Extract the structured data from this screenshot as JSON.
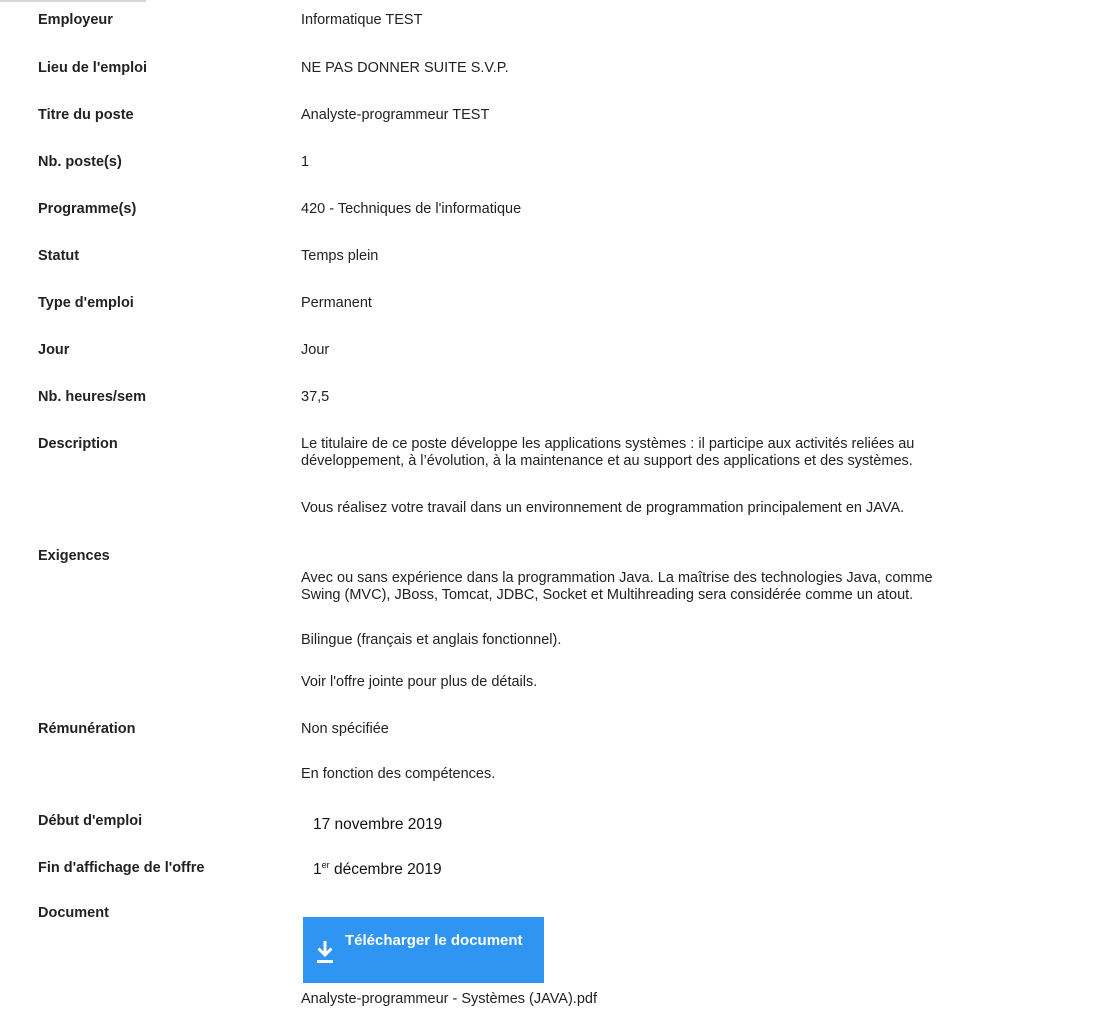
{
  "fields": {
    "employeur": {
      "label": "Employeur",
      "value": "Informatique TEST"
    },
    "lieu": {
      "label": "Lieu de l'emploi",
      "value": "NE PAS DONNER SUITE S.V.P."
    },
    "titre": {
      "label": "Titre du poste",
      "value": "Analyste-programmeur TEST"
    },
    "nb_postes": {
      "label": "Nb. poste(s)",
      "value": "1"
    },
    "programmes": {
      "label": "Programme(s)",
      "value": "420 - Techniques de l'informatique"
    },
    "statut": {
      "label": "Statut",
      "value": "Temps plein"
    },
    "type_emploi": {
      "label": "Type d'emploi",
      "value": "Permanent"
    },
    "jour": {
      "label": "Jour",
      "value": "Jour"
    },
    "heures": {
      "label": "Nb. heures/sem",
      "value": "37,5"
    },
    "description": {
      "label": "Description",
      "line1": "Le titulaire de ce poste développe les applications systèmes : il participe aux activités reliées au",
      "line2": "développement, à l’évolution, à la maintenance et au support des applications et des systèmes.",
      "para2": "Vous réalisez votre travail dans un environnement de programmation principalement en JAVA."
    },
    "exigences": {
      "label": "Exigences",
      "line1": "Avec ou sans expérience dans la programmation Java. La maîtrise des technologies Java, comme",
      "line2": "Swing (MVC), JBoss, Tomcat, JDBC, Socket et Multihreading sera considérée comme un atout.",
      "para2": "Bilingue (français et anglais fonctionnel).",
      "para3": "Voir l'offre jointe pour plus de détails."
    },
    "remuneration": {
      "label": "Rémunération",
      "value": "Non spécifiée",
      "note": "En fonction des compétences."
    },
    "debut": {
      "label": "Début d'emploi",
      "value": "17 novembre 2019"
    },
    "fin_affichage": {
      "label": "Fin d'affichage de l'offre",
      "day": "1",
      "suffix": "er",
      "rest": " décembre 2019"
    },
    "document": {
      "label": "Document",
      "button_label": "Télécharger le document",
      "filename": "Analyste-programmeur - Systèmes (JAVA).pdf"
    }
  },
  "icons": {
    "download": "download-icon"
  },
  "colors": {
    "button_bg": "#2f95f2",
    "button_text": "#ffffff",
    "label_text": "#222222"
  }
}
